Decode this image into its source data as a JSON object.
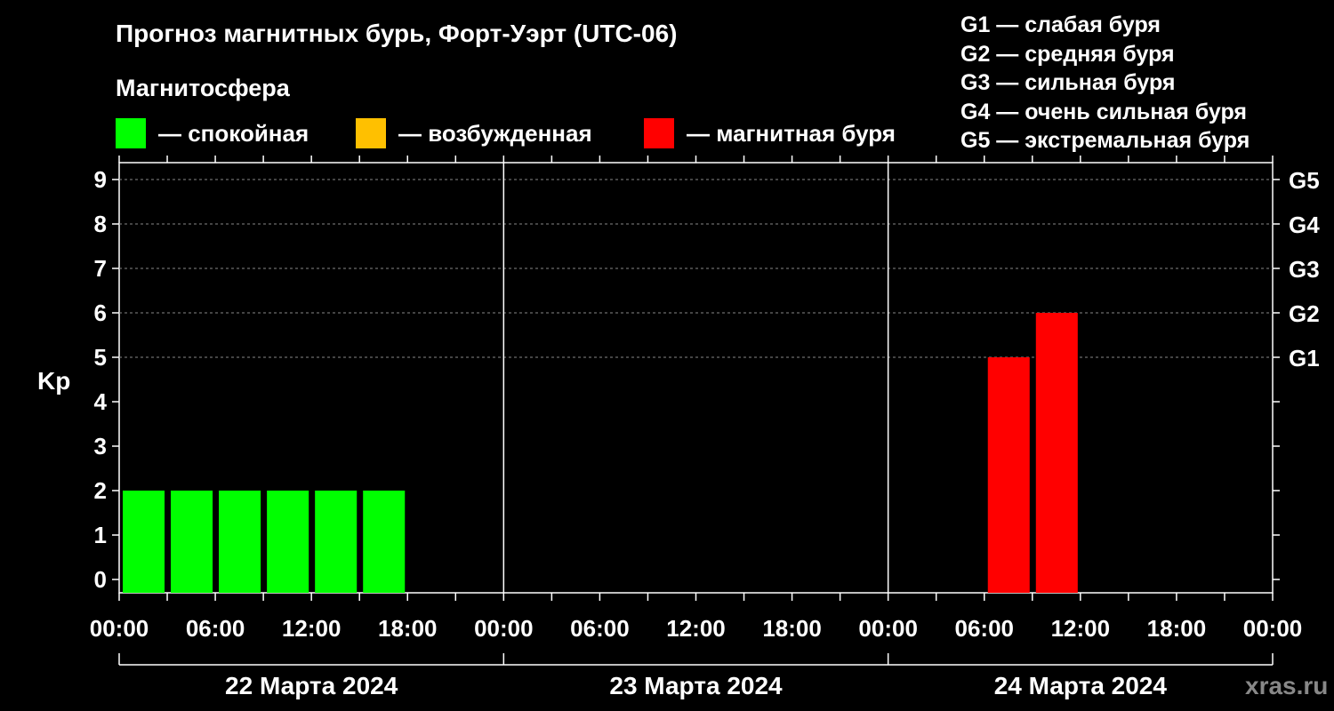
{
  "title": "Прогноз магнитных бурь, Форт-Уэрт (UTC-06)",
  "subtitle": "Магнитосфера",
  "legend": [
    {
      "label": "— спокойная",
      "color": "#00ff00"
    },
    {
      "label": "— возбужденная",
      "color": "#ffc000"
    },
    {
      "label": "— магнитная буря",
      "color": "#ff0000"
    }
  ],
  "g_legend": [
    "G1 — слабая буря",
    "G2 — средняя буря",
    "G3 — сильная буря",
    "G4 — очень сильная буря",
    "G5 — экстремальная буря"
  ],
  "watermark": "xras.ru",
  "chart_data": {
    "type": "bar",
    "ylabel": "Kp",
    "ylim": [
      0,
      9
    ],
    "y_ticks": [
      "0",
      "1",
      "2",
      "3",
      "4",
      "5",
      "6",
      "7",
      "8",
      "9"
    ],
    "right_axis_labels": [
      {
        "kp": 5,
        "label": "G1"
      },
      {
        "kp": 6,
        "label": "G2"
      },
      {
        "kp": 7,
        "label": "G3"
      },
      {
        "kp": 8,
        "label": "G4"
      },
      {
        "kp": 9,
        "label": "G5"
      }
    ],
    "x_tick_labels": [
      "00:00",
      "06:00",
      "12:00",
      "18:00",
      "00:00",
      "06:00",
      "12:00",
      "18:00",
      "00:00",
      "06:00",
      "12:00",
      "18:00",
      "00:00"
    ],
    "days": [
      "22 Марта 2024",
      "23 Марта 2024",
      "24 Марта 2024"
    ],
    "interval_hours": 3,
    "values": [
      2,
      2,
      2,
      2,
      2,
      2,
      null,
      null,
      null,
      null,
      null,
      null,
      null,
      null,
      null,
      null,
      null,
      null,
      5,
      6
    ],
    "colors": {
      "quiet": "#00ff00",
      "active": "#ffc000",
      "storm": "#ff0000"
    },
    "grid": true
  }
}
